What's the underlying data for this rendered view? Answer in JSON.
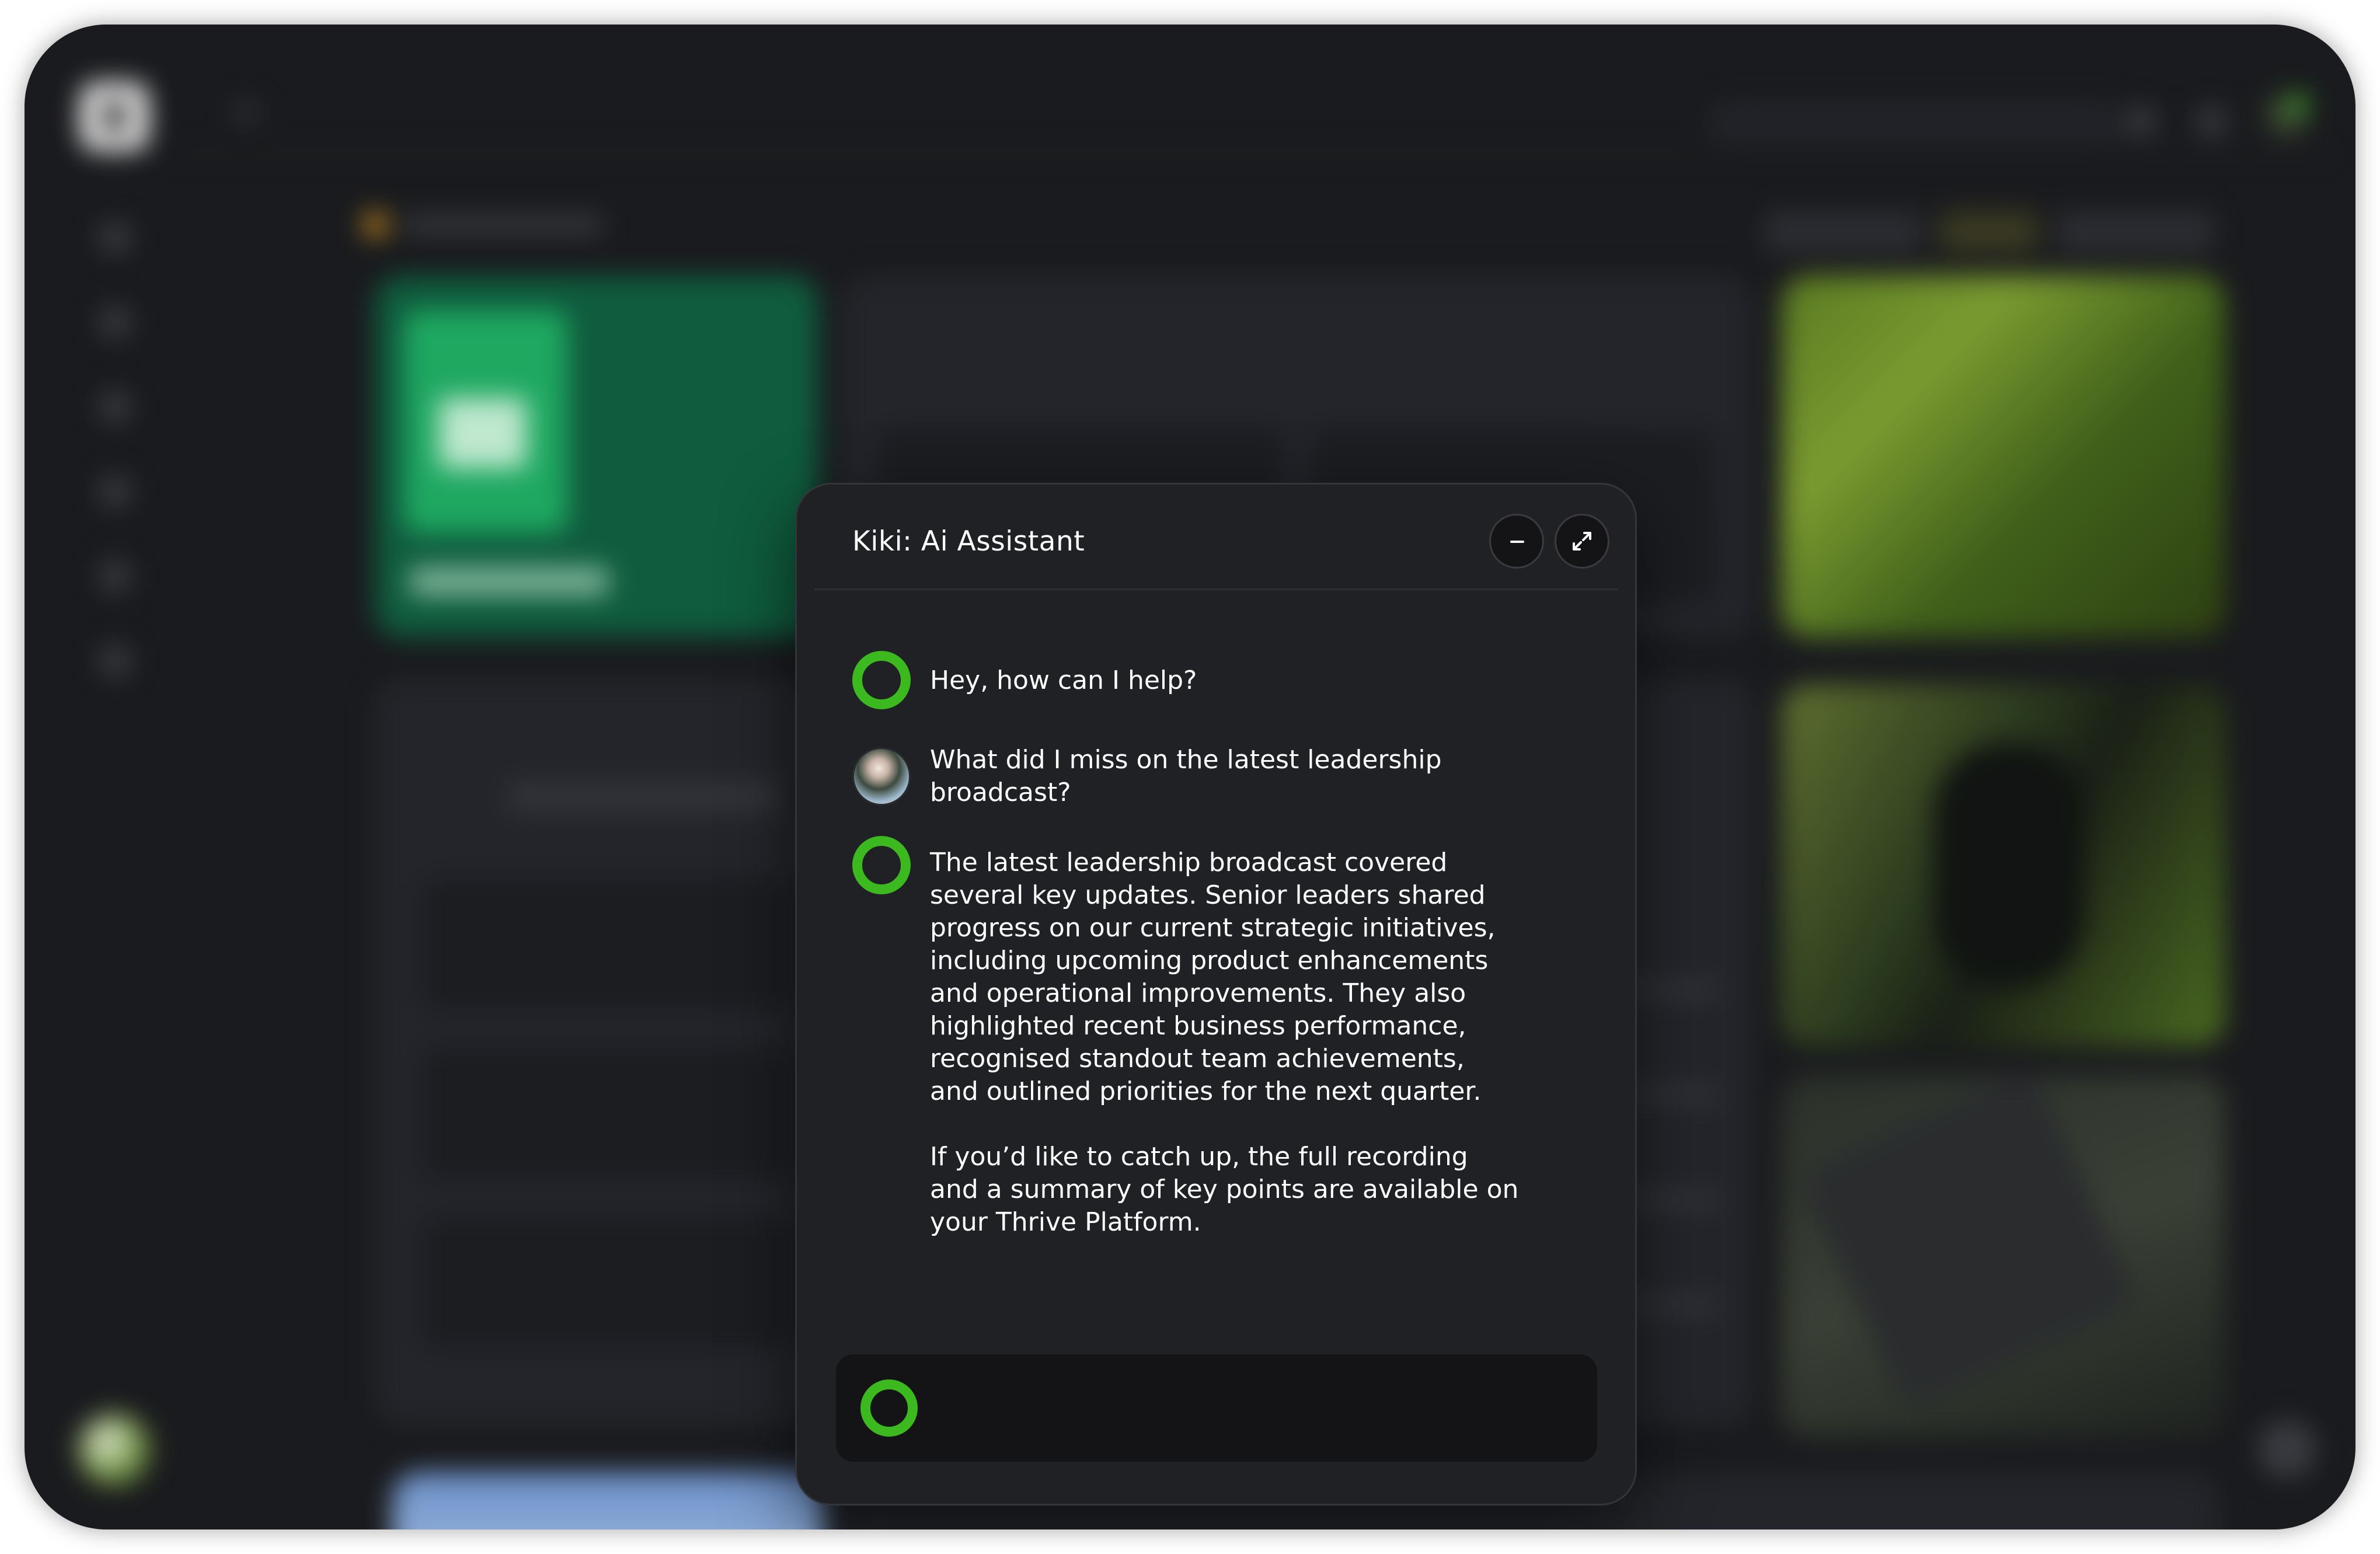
{
  "assistant": {
    "title": "Kiki: Ai Assistant",
    "minimize_icon": "minus-icon",
    "expand_icon": "expand-arrows-icon",
    "accent_color": "#3cb91e",
    "messages": [
      {
        "role": "assistant",
        "text": "Hey, how can I help?"
      },
      {
        "role": "user",
        "text": "What did I miss on the latest leadership broadcast?"
      },
      {
        "role": "assistant",
        "paragraphs": [
          "The latest leadership broadcast covered several key updates. Senior leaders shared progress on our current strategic initiatives, including upcoming product enhancements and operational improvements. They also highlighted recent business performance, recognised standout team achievements, and outlined priorities for the next quarter.",
          "If you’d like to catch up, the full recording and a summary of key points are available on your Thrive Platform."
        ]
      }
    ],
    "input": {
      "value": "",
      "placeholder": ""
    }
  },
  "background": {
    "blurred": true,
    "theme_color": "#1a1b1e",
    "green_card_color": "#0f5c3e"
  }
}
